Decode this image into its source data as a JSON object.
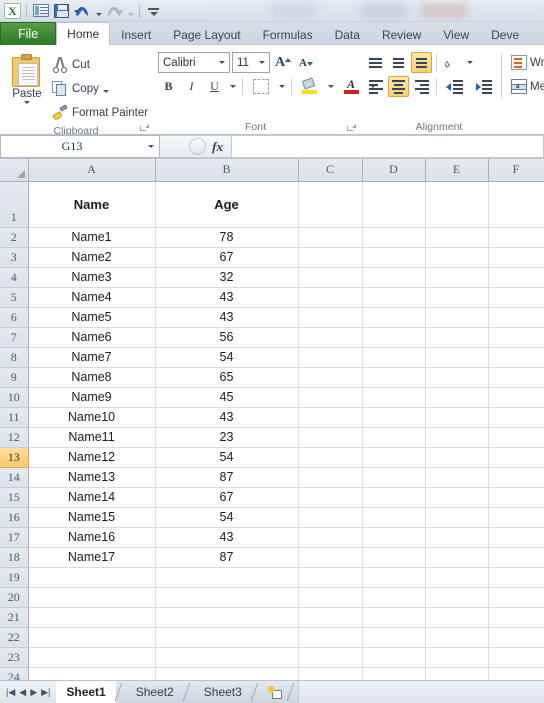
{
  "titlebar": {
    "quick_access": [
      {
        "name": "excel-logo-icon",
        "label": "X"
      },
      {
        "name": "new-window-icon",
        "label": ""
      },
      {
        "name": "save-icon",
        "label": ""
      },
      {
        "name": "undo-icon",
        "label": ""
      },
      {
        "name": "redo-icon",
        "label": ""
      },
      {
        "name": "customize-quick-access-icon",
        "label": ""
      }
    ]
  },
  "ribbon": {
    "tabs": [
      {
        "label": "File",
        "active": false
      },
      {
        "label": "Home",
        "active": true
      },
      {
        "label": "Insert",
        "active": false
      },
      {
        "label": "Page Layout",
        "active": false
      },
      {
        "label": "Formulas",
        "active": false
      },
      {
        "label": "Data",
        "active": false
      },
      {
        "label": "Review",
        "active": false
      },
      {
        "label": "View",
        "active": false
      },
      {
        "label": "Deve",
        "active": false
      }
    ],
    "clipboard": {
      "group_label": "Clipboard",
      "paste": "Paste",
      "cut": "Cut",
      "copy": "Copy",
      "format_painter": "Format Painter"
    },
    "font": {
      "group_label": "Font",
      "font_name": "Calibri",
      "font_size": "11",
      "bold": "B",
      "italic": "I",
      "underline": "U",
      "grow_font": "A",
      "shrink_font": "A",
      "font_color_letter": "A"
    },
    "alignment": {
      "group_label": "Alignment",
      "wrap_text": "Wrap",
      "merge_center": "Merg"
    }
  },
  "formula_bar": {
    "name_box": "G13",
    "fx_label": "fx",
    "formula_value": "",
    "formula_placeholder": ""
  },
  "grid": {
    "columns": [
      "A",
      "B",
      "C",
      "D",
      "E",
      "F"
    ],
    "selected_cell": "G13",
    "selected_row": 13,
    "rows": [
      {
        "num": "1",
        "header": true,
        "A": "Name",
        "B": "Age"
      },
      {
        "num": "2",
        "header": false,
        "A": "Name1",
        "B": "78"
      },
      {
        "num": "3",
        "header": false,
        "A": "Name2",
        "B": "67"
      },
      {
        "num": "4",
        "header": false,
        "A": "Name3",
        "B": "32"
      },
      {
        "num": "5",
        "header": false,
        "A": "Name4",
        "B": "43"
      },
      {
        "num": "6",
        "header": false,
        "A": "Name5",
        "B": "43"
      },
      {
        "num": "7",
        "header": false,
        "A": "Name6",
        "B": "56"
      },
      {
        "num": "8",
        "header": false,
        "A": "Name7",
        "B": "54"
      },
      {
        "num": "9",
        "header": false,
        "A": "Name8",
        "B": "65"
      },
      {
        "num": "10",
        "header": false,
        "A": "Name9",
        "B": "45"
      },
      {
        "num": "11",
        "header": false,
        "A": "Name10",
        "B": "43"
      },
      {
        "num": "12",
        "header": false,
        "A": "Name11",
        "B": "23"
      },
      {
        "num": "13",
        "header": false,
        "A": "Name12",
        "B": "54"
      },
      {
        "num": "14",
        "header": false,
        "A": "Name13",
        "B": "87"
      },
      {
        "num": "15",
        "header": false,
        "A": "Name14",
        "B": "67"
      },
      {
        "num": "16",
        "header": false,
        "A": "Name15",
        "B": "54"
      },
      {
        "num": "17",
        "header": false,
        "A": "Name16",
        "B": "43"
      },
      {
        "num": "18",
        "header": false,
        "A": "Name17",
        "B": "87"
      },
      {
        "num": "19",
        "header": false,
        "A": "",
        "B": ""
      },
      {
        "num": "20",
        "header": false,
        "A": "",
        "B": ""
      },
      {
        "num": "21",
        "header": false,
        "A": "",
        "B": ""
      },
      {
        "num": "22",
        "header": false,
        "A": "",
        "B": ""
      },
      {
        "num": "23",
        "header": false,
        "A": "",
        "B": ""
      },
      {
        "num": "24",
        "header": false,
        "A": "",
        "B": ""
      }
    ]
  },
  "sheet_tabs": {
    "nav_first": "|◀",
    "nav_prev": "◀",
    "nav_next": "▶",
    "nav_last": "▶|",
    "tabs": [
      {
        "label": "Sheet1",
        "active": true
      },
      {
        "label": "Sheet2",
        "active": false
      },
      {
        "label": "Sheet3",
        "active": false
      }
    ],
    "insert_sheet": ""
  },
  "colors": {
    "file_tab_green": "#3f8a34",
    "selection_amber": "#fcc86a",
    "header_grey": "#dbe1e8",
    "grid_line": "#d9dde2"
  }
}
